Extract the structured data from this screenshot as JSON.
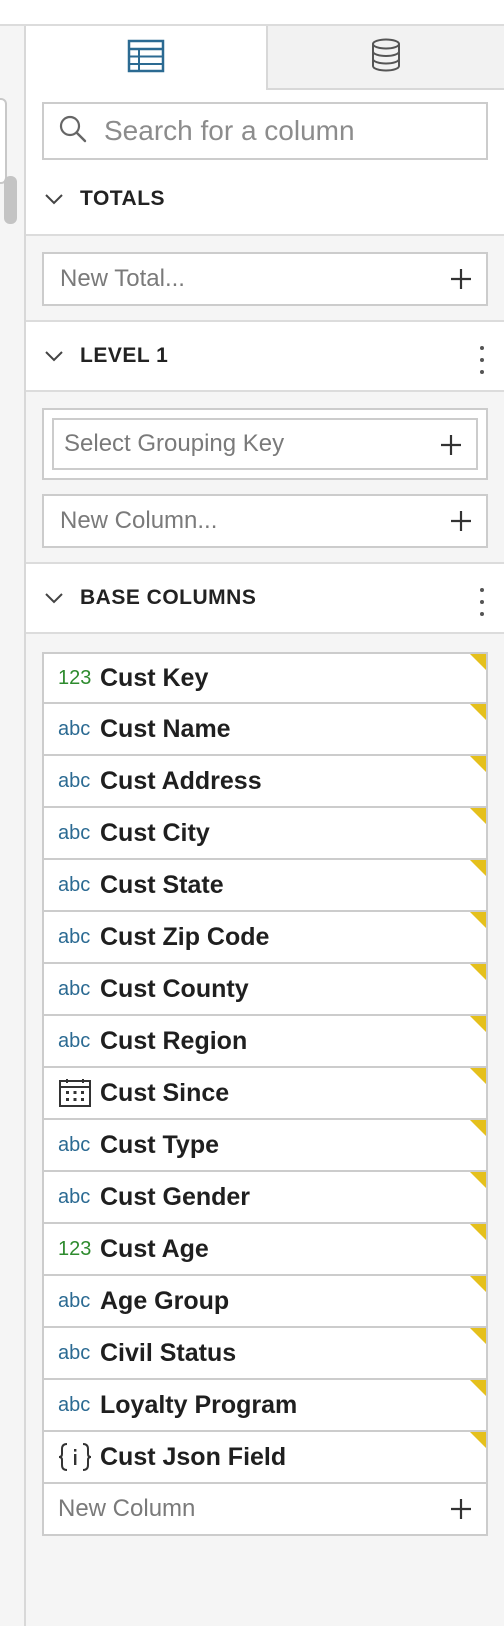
{
  "search": {
    "placeholder": "Search for a column"
  },
  "sections": {
    "totals": {
      "title": "TOTALS",
      "new_placeholder": "New Total..."
    },
    "level1": {
      "title": "LEVEL 1",
      "grouping_placeholder": "Select Grouping Key",
      "new_placeholder": "New Column..."
    },
    "base": {
      "title": "BASE COLUMNS",
      "new_placeholder": "New Column"
    }
  },
  "columns": [
    {
      "type": "123",
      "name": "Cust Key"
    },
    {
      "type": "abc",
      "name": "Cust Name"
    },
    {
      "type": "abc",
      "name": "Cust Address"
    },
    {
      "type": "abc",
      "name": "Cust City"
    },
    {
      "type": "abc",
      "name": "Cust State"
    },
    {
      "type": "abc",
      "name": "Cust Zip Code"
    },
    {
      "type": "abc",
      "name": "Cust County"
    },
    {
      "type": "abc",
      "name": "Cust Region"
    },
    {
      "type": "calendar-icon",
      "name": "Cust Since"
    },
    {
      "type": "abc",
      "name": "Cust Type"
    },
    {
      "type": "abc",
      "name": "Cust Gender"
    },
    {
      "type": "123",
      "name": "Cust Age"
    },
    {
      "type": "abc",
      "name": "Age Group"
    },
    {
      "type": "abc",
      "name": "Civil Status"
    },
    {
      "type": "abc",
      "name": "Loyalty Program"
    },
    {
      "type": "json-icon",
      "name": "Cust Json Field"
    }
  ],
  "colors": {
    "accent": "#2b6a92",
    "number_type": "#2e8b2e",
    "flag": "#e5c01c"
  }
}
